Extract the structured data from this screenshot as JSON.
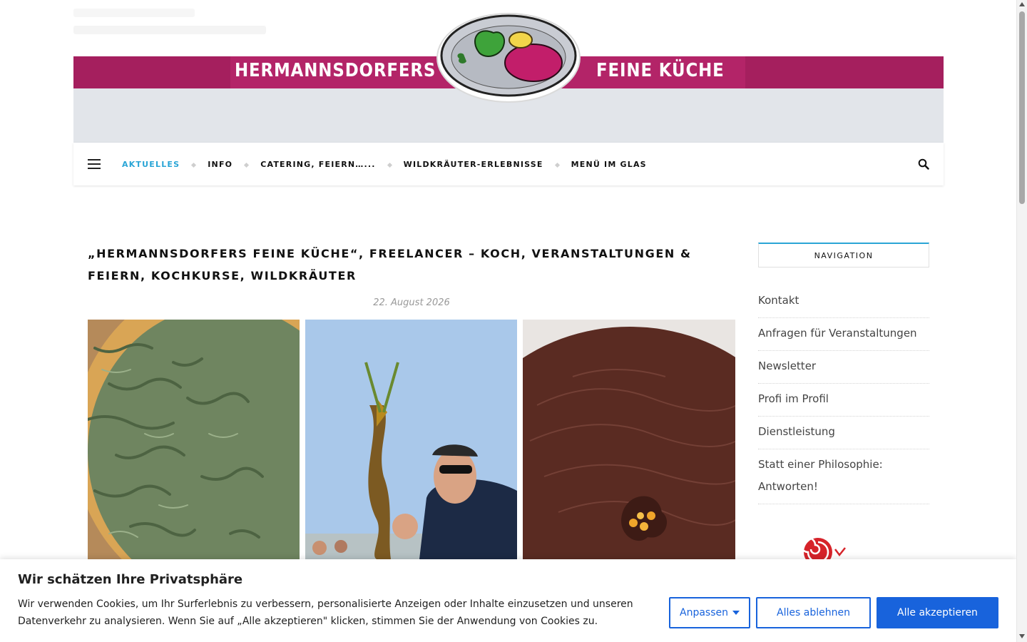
{
  "header": {
    "brand_left": "HERMANNSDORFERS",
    "brand_right": "FEINE KÜCHE"
  },
  "nav": {
    "items": [
      {
        "label": "AKTUELLES",
        "active": true
      },
      {
        "label": "INFO"
      },
      {
        "label": "CATERING, FEIERN…..."
      },
      {
        "label": "WILDKRÄUTER-ERLEBNISSE"
      },
      {
        "label": "MENÜ IM GLAS"
      }
    ],
    "accent_color": "#2aa5d6"
  },
  "post": {
    "title": "„HERMANNSDORFERS FEINE KÜCHE“, FREELANCER – KOCH, VERANSTALTUNGEN & FEIERN, KOCHKURSE, WILDKRÄUTER",
    "date": "22. August 2026"
  },
  "sidebar": {
    "widget_title": "NAVIGATION",
    "items": [
      {
        "label": "Kontakt"
      },
      {
        "label": "Anfragen für Veranstaltungen"
      },
      {
        "label": "Newsletter"
      },
      {
        "label": "Profi im Profil"
      },
      {
        "label": "Dienstleistung"
      },
      {
        "label": "Statt einer Philosophie: Antworten!"
      }
    ]
  },
  "cookie": {
    "title": "Wir schätzen Ihre Privatsphäre",
    "text": "Wir verwenden Cookies, um Ihr Surferlebnis zu verbessern, personalisierte Anzeigen oder Inhalte einzusetzen und unseren Datenverkehr zu analysieren. Wenn Sie auf „Alle akzeptieren\" klicken, stimmen Sie der Anwendung von Cookies zu.",
    "customize_label": "Anpassen",
    "reject_label": "Alles ablehnen",
    "accept_label": "Alle akzeptieren",
    "button_color": "#1863dc"
  },
  "colors": {
    "brand_band": "#a51f5e",
    "header_gray": "#e2e5ea"
  }
}
